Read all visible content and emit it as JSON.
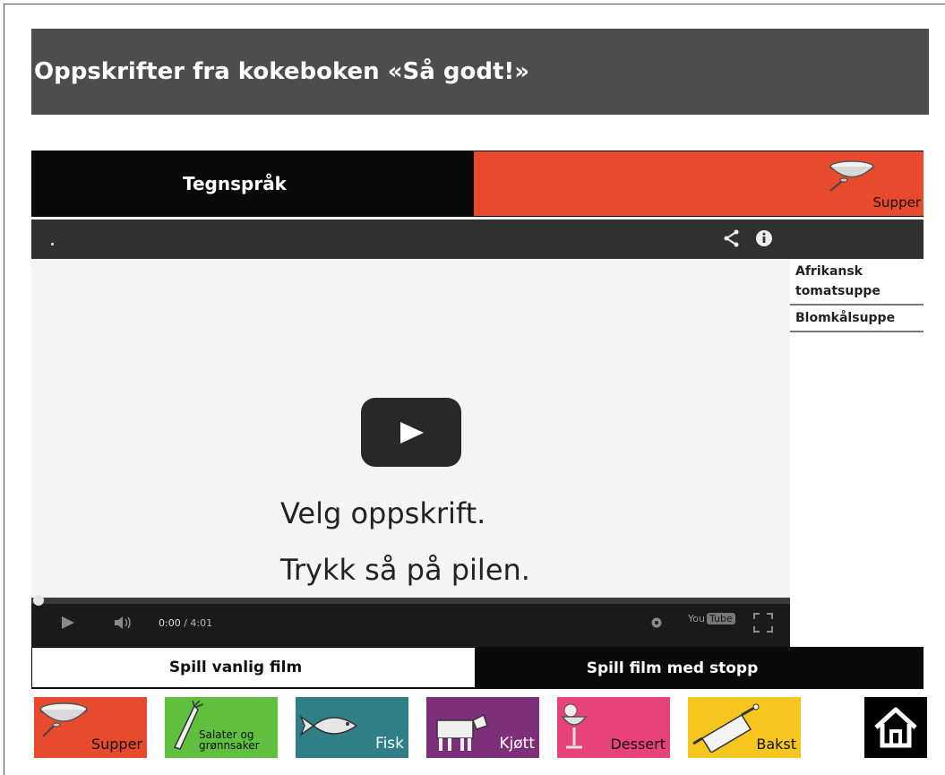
{
  "header": {
    "title": "Oppskrifter fra kokeboken «Så godt!»"
  },
  "top_tabs": {
    "sign_language": "Tegnspråk",
    "category": "Supper"
  },
  "video": {
    "message_line1": "Velg oppskrift.",
    "message_line2": "Trykk så på pilen.",
    "time_current": "0:00",
    "time_total": "/ 4:01",
    "youtube_label": "You",
    "youtube_tube": "Tube"
  },
  "recipes": [
    {
      "label": "Afrikansk tomatsuppe"
    },
    {
      "label": "Blomkålsuppe"
    }
  ],
  "bottom_tabs": {
    "regular": "Spill vanlig film",
    "with_stops": "Spill film med stopp"
  },
  "categories": [
    {
      "label": "Supper",
      "color": "#e84a2d",
      "icon": "bowl-icon"
    },
    {
      "label": "Salater og grønnsaker",
      "color": "#5fbf3f",
      "icon": "carrot-icon"
    },
    {
      "label": "Fisk",
      "color": "#2f7f87",
      "icon": "fish-icon"
    },
    {
      "label": "Kjøtt",
      "color": "#7d2f7a",
      "icon": "cow-icon"
    },
    {
      "label": "Dessert",
      "color": "#e8427a",
      "icon": "sundae-icon"
    },
    {
      "label": "Bakst",
      "color": "#f7c520",
      "icon": "rolling-pin-icon"
    }
  ],
  "colors": {
    "header_bg": "#4d4d4d",
    "accent_red": "#e84a2d",
    "tab_dark": "#0a0a0a"
  }
}
